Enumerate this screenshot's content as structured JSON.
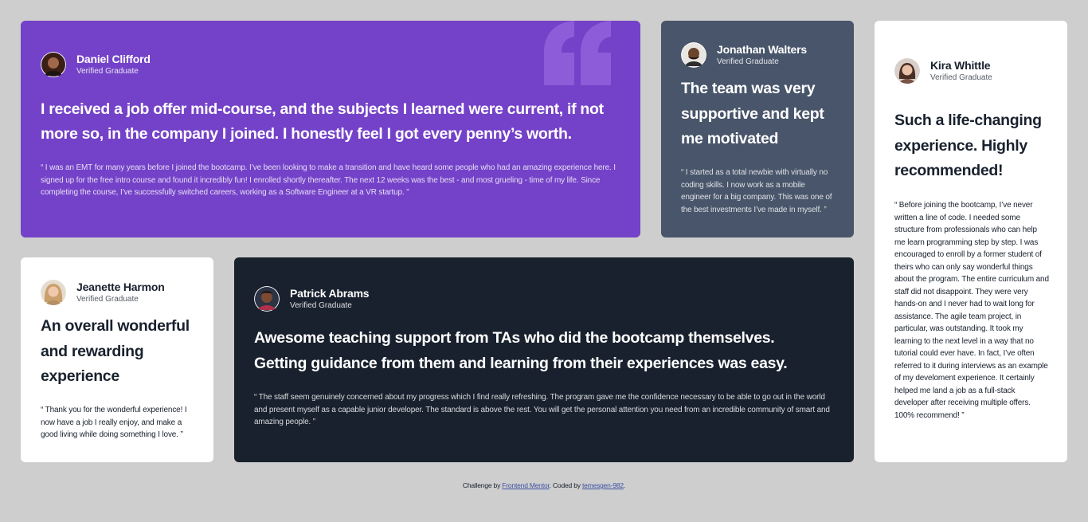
{
  "colors": {
    "page_bg": "#cecece",
    "moderate_violet": "#7442c8",
    "grayish_blue": "#48556a",
    "very_dark_blackish_blue": "#19212e",
    "white": "#ffffff",
    "quote_mark": "#8c5cd9"
  },
  "testimonials": [
    {
      "name": "Daniel Clifford",
      "role": "Verified Graduate",
      "avatar_icon": "daniel-avatar",
      "headline": "I received a job offer mid-course, and the subjects I learned were current, if not more so, in the company I joined. I honestly feel I got every penny’s worth.",
      "body": "“ I was an EMT for many years before I joined the bootcamp. I’ve been looking to make a transition and have heard some people who had an amazing experience here. I signed up for the free intro course and found it incredibly fun! I enrolled shortly thereafter. The next 12 weeks was the best - and most grueling - time of my life. Since completing the course, I’ve successfully switched careers, working as a Software Engineer at a VR startup. ”"
    },
    {
      "name": "Jonathan Walters",
      "role": "Verified Graduate",
      "avatar_icon": "jonathan-avatar",
      "headline": "The team was very supportive and kept me motivated",
      "body": "“ I started as a total newbie with virtually no coding skills. I now work as a mobile engineer for a big company. This was one of the best investments I’ve made in myself. ”"
    },
    {
      "name": "Kira Whittle",
      "role": "Verified Graduate",
      "avatar_icon": "kira-avatar",
      "headline": "Such a life-changing experience. Highly recommended!",
      "body": "“ Before joining the bootcamp, I’ve never written a line of code. I needed some structure from professionals who can help me learn programming step by step. I was encouraged to enroll by a former student of theirs who can only say wonderful things about the program. The entire curriculum and staff did not disappoint. They were very hands-on and I never had to wait long for assistance. The agile team project, in particular, was outstanding. It took my learning to the next level in a way that no tutorial could ever have. In fact, I’ve often referred to it during interviews as an example of my develoment experience. It certainly helped me land a job as a full-stack developer after receiving multiple offers. 100% recommend! ”"
    },
    {
      "name": "Jeanette Harmon",
      "role": "Verified Graduate",
      "avatar_icon": "jeanette-avatar",
      "headline": "An overall wonderful and rewarding experience",
      "body": "“ Thank you for the wonderful experience! I now have a job I really enjoy, and make a good living while doing something I love. ”"
    },
    {
      "name": "Patrick Abrams",
      "role": "Verified Graduate",
      "avatar_icon": "patrick-avatar",
      "headline": "Awesome teaching support from TAs who did the bootcamp themselves. Getting guidance from them and learning from their experiences was easy.",
      "body": "“ The staff seem genuinely concerned about my progress which I find really refreshing. The program gave me the confidence necessary to be able to go out in the world and present myself as a capable junior developer. The standard is above the rest. You will get the personal attention you need from an incredible community of smart and amazing people. ”"
    }
  ],
  "footer": {
    "prefix": "Challenge by",
    "link1": "Frontend Mentor",
    "middle": ". Coded by",
    "link2": "temesgen-982",
    "suffix": "."
  }
}
